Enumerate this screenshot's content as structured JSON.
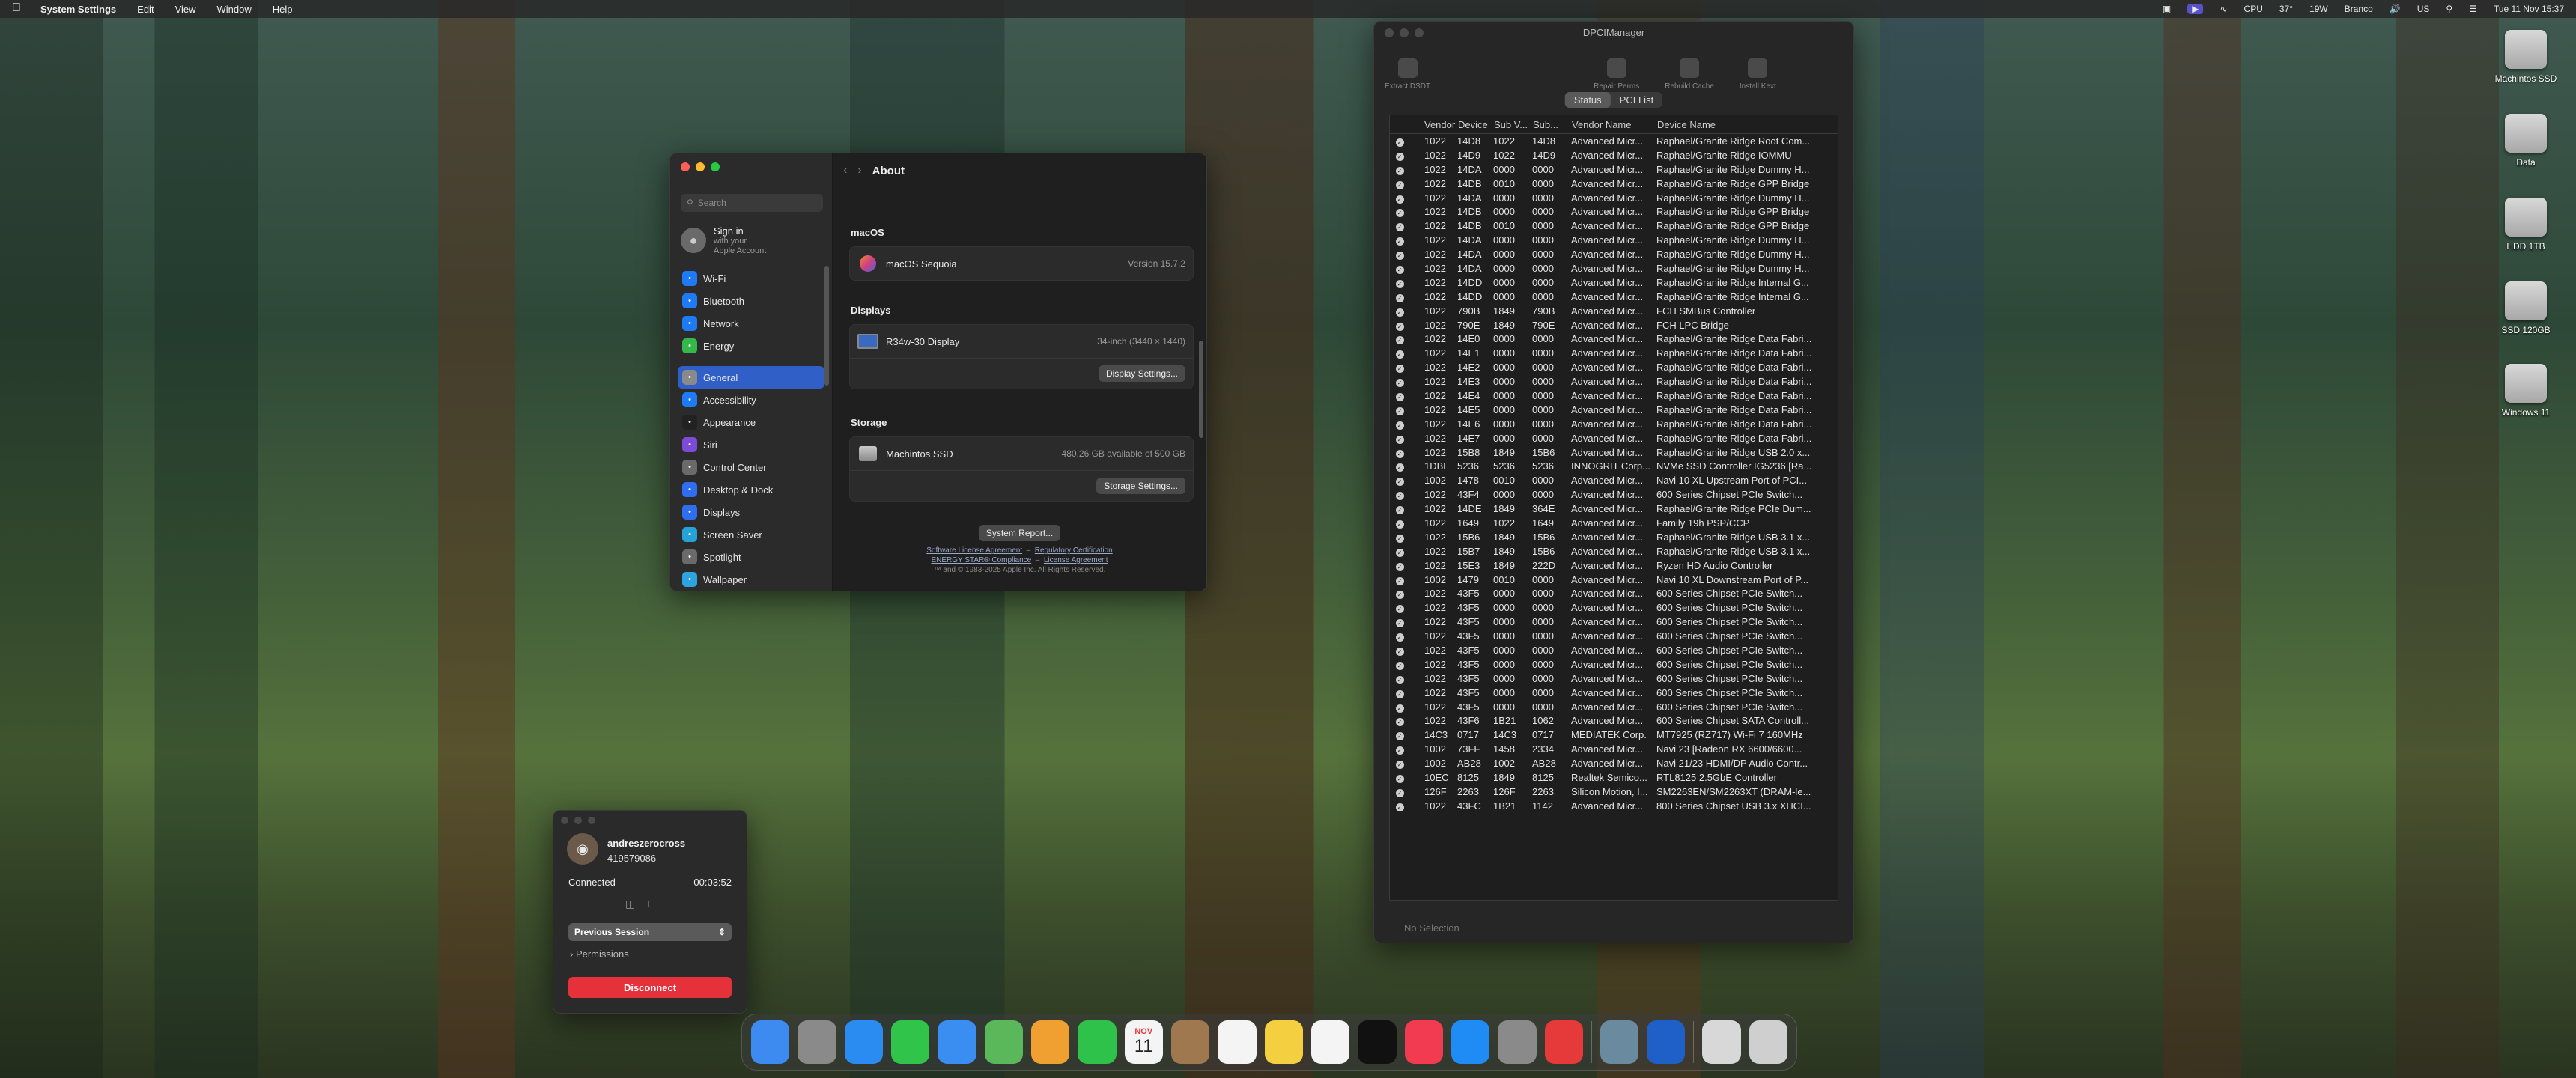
{
  "menubar": {
    "app_name": "System Settings",
    "menus": [
      "Edit",
      "View",
      "Window",
      "Help"
    ],
    "status": {
      "cpu": "CPU",
      "temp": "37°",
      "power": "19W",
      "user": "Branco",
      "clock": "Tue 11 Nov 15:37"
    }
  },
  "settings": {
    "title": "About",
    "search_placeholder": "Search",
    "signin": {
      "title": "Sign in",
      "sub1": "with your",
      "sub2": "Apple Account"
    },
    "sidebar_items": [
      {
        "label": "Wi-Fi",
        "color": "#1e7bf5"
      },
      {
        "label": "Bluetooth",
        "color": "#1e7bf5"
      },
      {
        "label": "Network",
        "color": "#1e7bf5"
      },
      {
        "label": "Energy",
        "color": "#35b84a"
      },
      {
        "label": "General",
        "color": "#8a8a8a",
        "active": true
      },
      {
        "label": "Accessibility",
        "color": "#1e7bf5"
      },
      {
        "label": "Appearance",
        "color": "#222222"
      },
      {
        "label": "Siri",
        "color": "#7c4bd8"
      },
      {
        "label": "Control Center",
        "color": "#6a6a6a"
      },
      {
        "label": "Desktop & Dock",
        "color": "#2f6ef0"
      },
      {
        "label": "Displays",
        "color": "#2f6ef0"
      },
      {
        "label": "Screen Saver",
        "color": "#27a2d8"
      },
      {
        "label": "Spotlight",
        "color": "#6a6a6a"
      },
      {
        "label": "Wallpaper",
        "color": "#2fa3e0"
      }
    ],
    "macos": {
      "heading": "macOS",
      "name": "macOS Sequoia",
      "version": "Version 15.7.2"
    },
    "displays": {
      "heading": "Displays",
      "name": "R34w-30 Display",
      "detail": "34-inch (3440 × 1440)",
      "button": "Display Settings..."
    },
    "storage": {
      "heading": "Storage",
      "name": "Machintos SSD",
      "detail": "480,26 GB available of 500 GB",
      "button": "Storage Settings..."
    },
    "system_report": "System Report...",
    "footer": {
      "link1": "Software License Agreement",
      "link2": "Regulatory Certification",
      "link3": "ENERGY STAR® Compliance",
      "link4": "License Agreement",
      "copyright": "™ and © 1983-2025 Apple Inc. All Rights Reserved."
    }
  },
  "dpci": {
    "title": "DPCIManager",
    "toolbar": [
      "Extract DSDT",
      "Repair Perms",
      "Rebuild Cache",
      "Install Kext"
    ],
    "tabs": [
      "Status",
      "PCI List"
    ],
    "columns": [
      "Vendor",
      "Device",
      "Sub V...",
      "Sub...",
      "Vendor Name",
      "Device Name"
    ],
    "rows": [
      [
        "1022",
        "14D8",
        "1022",
        "14D8",
        "Advanced Micr...",
        "Raphael/Granite Ridge Root Com..."
      ],
      [
        "1022",
        "14D9",
        "1022",
        "14D9",
        "Advanced Micr...",
        "Raphael/Granite Ridge IOMMU"
      ],
      [
        "1022",
        "14DA",
        "0000",
        "0000",
        "Advanced Micr...",
        "Raphael/Granite Ridge Dummy H..."
      ],
      [
        "1022",
        "14DB",
        "0010",
        "0000",
        "Advanced Micr...",
        "Raphael/Granite Ridge GPP Bridge"
      ],
      [
        "1022",
        "14DA",
        "0000",
        "0000",
        "Advanced Micr...",
        "Raphael/Granite Ridge Dummy H..."
      ],
      [
        "1022",
        "14DB",
        "0000",
        "0000",
        "Advanced Micr...",
        "Raphael/Granite Ridge GPP Bridge"
      ],
      [
        "1022",
        "14DB",
        "0010",
        "0000",
        "Advanced Micr...",
        "Raphael/Granite Ridge GPP Bridge"
      ],
      [
        "1022",
        "14DA",
        "0000",
        "0000",
        "Advanced Micr...",
        "Raphael/Granite Ridge Dummy H..."
      ],
      [
        "1022",
        "14DA",
        "0000",
        "0000",
        "Advanced Micr...",
        "Raphael/Granite Ridge Dummy H..."
      ],
      [
        "1022",
        "14DA",
        "0000",
        "0000",
        "Advanced Micr...",
        "Raphael/Granite Ridge Dummy H..."
      ],
      [
        "1022",
        "14DD",
        "0000",
        "0000",
        "Advanced Micr...",
        "Raphael/Granite Ridge Internal G..."
      ],
      [
        "1022",
        "14DD",
        "0000",
        "0000",
        "Advanced Micr...",
        "Raphael/Granite Ridge Internal G..."
      ],
      [
        "1022",
        "790B",
        "1849",
        "790B",
        "Advanced Micr...",
        "FCH SMBus Controller"
      ],
      [
        "1022",
        "790E",
        "1849",
        "790E",
        "Advanced Micr...",
        "FCH LPC Bridge"
      ],
      [
        "1022",
        "14E0",
        "0000",
        "0000",
        "Advanced Micr...",
        "Raphael/Granite Ridge Data Fabri..."
      ],
      [
        "1022",
        "14E1",
        "0000",
        "0000",
        "Advanced Micr...",
        "Raphael/Granite Ridge Data Fabri..."
      ],
      [
        "1022",
        "14E2",
        "0000",
        "0000",
        "Advanced Micr...",
        "Raphael/Granite Ridge Data Fabri..."
      ],
      [
        "1022",
        "14E3",
        "0000",
        "0000",
        "Advanced Micr...",
        "Raphael/Granite Ridge Data Fabri..."
      ],
      [
        "1022",
        "14E4",
        "0000",
        "0000",
        "Advanced Micr...",
        "Raphael/Granite Ridge Data Fabri..."
      ],
      [
        "1022",
        "14E5",
        "0000",
        "0000",
        "Advanced Micr...",
        "Raphael/Granite Ridge Data Fabri..."
      ],
      [
        "1022",
        "14E6",
        "0000",
        "0000",
        "Advanced Micr...",
        "Raphael/Granite Ridge Data Fabri..."
      ],
      [
        "1022",
        "14E7",
        "0000",
        "0000",
        "Advanced Micr...",
        "Raphael/Granite Ridge Data Fabri..."
      ],
      [
        "1022",
        "15B8",
        "1849",
        "15B6",
        "Advanced Micr...",
        "Raphael/Granite Ridge USB 2.0 x..."
      ],
      [
        "1DBE",
        "5236",
        "5236",
        "5236",
        "INNOGRIT Corp...",
        "NVMe SSD Controller IG5236 [Ra..."
      ],
      [
        "1002",
        "1478",
        "0010",
        "0000",
        "Advanced Micr...",
        "Navi 10 XL Upstream Port of PCI..."
      ],
      [
        "1022",
        "43F4",
        "0000",
        "0000",
        "Advanced Micr...",
        "600 Series Chipset PCIe Switch..."
      ],
      [
        "1022",
        "14DE",
        "1849",
        "364E",
        "Advanced Micr...",
        "Raphael/Granite Ridge PCIe Dum..."
      ],
      [
        "1022",
        "1649",
        "1022",
        "1649",
        "Advanced Micr...",
        "Family 19h PSP/CCP"
      ],
      [
        "1022",
        "15B6",
        "1849",
        "15B6",
        "Advanced Micr...",
        "Raphael/Granite Ridge USB 3.1 x..."
      ],
      [
        "1022",
        "15B7",
        "1849",
        "15B6",
        "Advanced Micr...",
        "Raphael/Granite Ridge USB 3.1 x..."
      ],
      [
        "1022",
        "15E3",
        "1849",
        "222D",
        "Advanced Micr...",
        "Ryzen HD Audio Controller"
      ],
      [
        "1002",
        "1479",
        "0010",
        "0000",
        "Advanced Micr...",
        "Navi 10 XL Downstream Port of P..."
      ],
      [
        "1022",
        "43F5",
        "0000",
        "0000",
        "Advanced Micr...",
        "600 Series Chipset PCIe Switch..."
      ],
      [
        "1022",
        "43F5",
        "0000",
        "0000",
        "Advanced Micr...",
        "600 Series Chipset PCIe Switch..."
      ],
      [
        "1022",
        "43F5",
        "0000",
        "0000",
        "Advanced Micr...",
        "600 Series Chipset PCIe Switch..."
      ],
      [
        "1022",
        "43F5",
        "0000",
        "0000",
        "Advanced Micr...",
        "600 Series Chipset PCIe Switch..."
      ],
      [
        "1022",
        "43F5",
        "0000",
        "0000",
        "Advanced Micr...",
        "600 Series Chipset PCIe Switch..."
      ],
      [
        "1022",
        "43F5",
        "0000",
        "0000",
        "Advanced Micr...",
        "600 Series Chipset PCIe Switch..."
      ],
      [
        "1022",
        "43F5",
        "0000",
        "0000",
        "Advanced Micr...",
        "600 Series Chipset PCIe Switch..."
      ],
      [
        "1022",
        "43F5",
        "0000",
        "0000",
        "Advanced Micr...",
        "600 Series Chipset PCIe Switch..."
      ],
      [
        "1022",
        "43F5",
        "0000",
        "0000",
        "Advanced Micr...",
        "600 Series Chipset PCIe Switch..."
      ],
      [
        "1022",
        "43F6",
        "1B21",
        "1062",
        "Advanced Micr...",
        "600 Series Chipset SATA Controll..."
      ],
      [
        "14C3",
        "0717",
        "14C3",
        "0717",
        "MEDIATEK Corp.",
        "MT7925 (RZ717) Wi-Fi 7 160MHz"
      ],
      [
        "1002",
        "73FF",
        "1458",
        "2334",
        "Advanced Micr...",
        "Navi 23 [Radeon RX 6600/6600..."
      ],
      [
        "1002",
        "AB28",
        "1002",
        "AB28",
        "Advanced Micr...",
        "Navi 21/23 HDMI/DP Audio Contr..."
      ],
      [
        "10EC",
        "8125",
        "1849",
        "8125",
        "Realtek Semico...",
        "RTL8125 2.5GbE Controller"
      ],
      [
        "126F",
        "2263",
        "126F",
        "2263",
        "Silicon Motion, I...",
        "SM2263EN/SM2263XT (DRAM-le..."
      ],
      [
        "1022",
        "43FC",
        "1B21",
        "1142",
        "Advanced Micr...",
        "800 Series Chipset USB 3.x XHCI..."
      ]
    ],
    "status": "No Selection"
  },
  "remote": {
    "name": "andreszerocross",
    "id": "419579086",
    "status": "Connected",
    "timer": "00:03:52",
    "session_select": "Previous Session",
    "permissions": "Permissions",
    "disconnect": "Disconnect"
  },
  "desktop_icons": [
    "Machintos SSD",
    "Data",
    "HDD 1TB",
    "SSD 120GB",
    "Windows 11"
  ],
  "dock": {
    "calendar_month": "NOV",
    "calendar_day": "11",
    "apps": [
      {
        "name": "finder-icon",
        "color": "#3d8bf0"
      },
      {
        "name": "launchpad-icon",
        "color": "#8a8a8a"
      },
      {
        "name": "safari-icon",
        "color": "#2a8cf0"
      },
      {
        "name": "messages-icon",
        "color": "#30c54a"
      },
      {
        "name": "mail-icon",
        "color": "#3a8ef2"
      },
      {
        "name": "maps-icon",
        "color": "#5ab85a"
      },
      {
        "name": "photos-icon",
        "color": "#f0a030"
      },
      {
        "name": "facetime-icon",
        "color": "#2fc24a"
      },
      {
        "name": "calendar-icon",
        "color": "#f4f4f4"
      },
      {
        "name": "contacts-icon",
        "color": "#a07850"
      },
      {
        "name": "reminders-icon",
        "color": "#f4f4f4"
      },
      {
        "name": "notes-icon",
        "color": "#f4d040"
      },
      {
        "name": "freeform-icon",
        "color": "#f4f4f4"
      },
      {
        "name": "tv-icon",
        "color": "#111111"
      },
      {
        "name": "music-icon",
        "color": "#f23a50"
      },
      {
        "name": "app-store-icon",
        "color": "#1e8cf4"
      },
      {
        "name": "system-settings-icon",
        "color": "#8a8a8a"
      },
      {
        "name": "anydesk-icon",
        "color": "#e63a3a"
      },
      {
        "name": "preview-icon",
        "color": "#6a8aa0"
      },
      {
        "name": "info-icon",
        "color": "#1e5fc8"
      }
    ]
  }
}
